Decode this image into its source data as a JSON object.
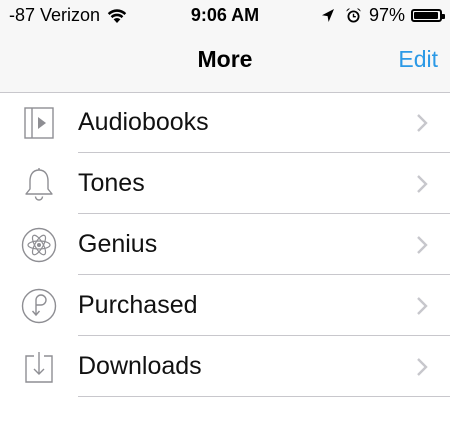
{
  "status_bar": {
    "carrier": "-87 Verizon",
    "time": "9:06 AM",
    "battery": "97%",
    "battery_level": 0.97,
    "icons": [
      "wifi-icon",
      "location-arrow-icon",
      "alarm-clock-icon",
      "battery-icon"
    ]
  },
  "nav": {
    "title": "More",
    "edit_label": "Edit",
    "accent_color": "#2b99e6"
  },
  "list": {
    "items": [
      {
        "label": "Audiobooks",
        "icon": "audiobook-icon"
      },
      {
        "label": "Tones",
        "icon": "bell-icon"
      },
      {
        "label": "Genius",
        "icon": "genius-atom-icon"
      },
      {
        "label": "Purchased",
        "icon": "purchased-icon"
      },
      {
        "label": "Downloads",
        "icon": "download-icon"
      }
    ]
  }
}
